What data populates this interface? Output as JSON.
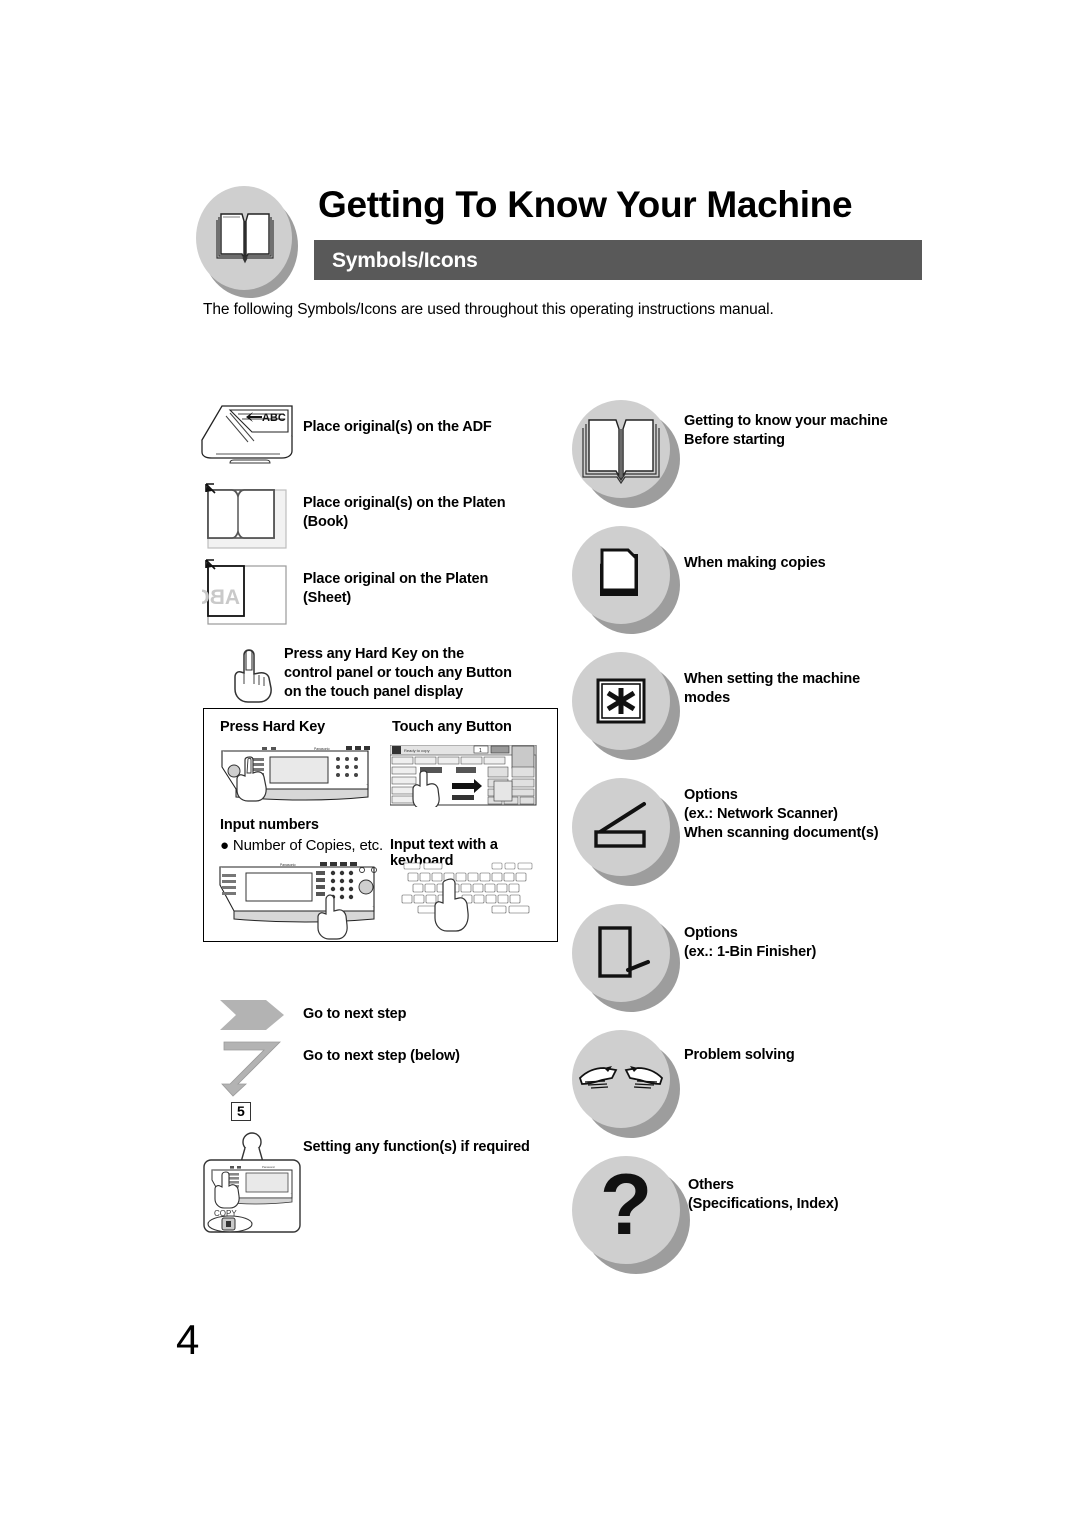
{
  "header": {
    "title": "Getting To Know Your Machine",
    "section_label": "Symbols/Icons",
    "badge_icon": "open-book-icon"
  },
  "intro": "The following Symbols/Icons are used throughout this operating instructions manual.",
  "page_number": "4",
  "left_column": {
    "items": [
      {
        "icon": "adf-scanner-icon",
        "label": "Place original(s) on the ADF"
      },
      {
        "icon": "platen-book-icon",
        "label_line1": "Place original(s) on the Platen",
        "label_line2": "(Book)"
      },
      {
        "icon": "platen-sheet-icon",
        "label_line1": "Place original on the Platen",
        "label_line2": "(Sheet)"
      },
      {
        "icon": "pointing-hand-icon",
        "label_line1": "Press any Hard Key on the",
        "label_line2": "control panel or touch any Button",
        "label_line3": "on the touch panel display"
      },
      {
        "icon": "chevron-arrow-icon",
        "label": "Go to next step"
      },
      {
        "icon": "bent-down-arrow-icon",
        "label": "Go to next step (below)",
        "step_badge": "5"
      },
      {
        "icon": "control-panel-magnifier-icon",
        "label": "Setting any function(s) if required"
      }
    ],
    "panel_box": {
      "captions": [
        {
          "name": "press-hard-key",
          "text": "Press Hard Key"
        },
        {
          "name": "touch-any-button",
          "text": "Touch any Button"
        },
        {
          "name": "input-numbers",
          "text": "Input numbers"
        },
        {
          "name": "input-numbers-bullet",
          "text": "● Number of Copies, etc."
        },
        {
          "name": "input-text-keyboard",
          "text": "Input text with a keyboard"
        }
      ]
    }
  },
  "right_column": {
    "items": [
      {
        "icon": "open-book-icon",
        "label_line1": "Getting to know your machine",
        "label_line2": "Before starting"
      },
      {
        "icon": "copy-pages-icon",
        "label_line1": "When making copies"
      },
      {
        "icon": "asterisk-box-icon",
        "label_line1": "When setting the machine",
        "label_line2": "modes"
      },
      {
        "icon": "flatbed-scanner-icon",
        "label_line1": "Options",
        "label_line2": "(ex.: Network Scanner)",
        "label_line3": "When scanning document(s)"
      },
      {
        "icon": "finisher-bin-icon",
        "label_line1": "Options",
        "label_line2": "(ex.: 1-Bin Finisher)"
      },
      {
        "icon": "helping-hands-icon",
        "label_line1": "Problem solving"
      },
      {
        "icon": "question-mark-icon",
        "label_line1": "Others",
        "label_line2": "(Specifications, Index)"
      }
    ]
  },
  "colors": {
    "subbar": "#595959",
    "circle_face": "#cfcfcf",
    "circle_shadow": "#9d9d9d",
    "arrow_gray": "#aaaaaa"
  }
}
